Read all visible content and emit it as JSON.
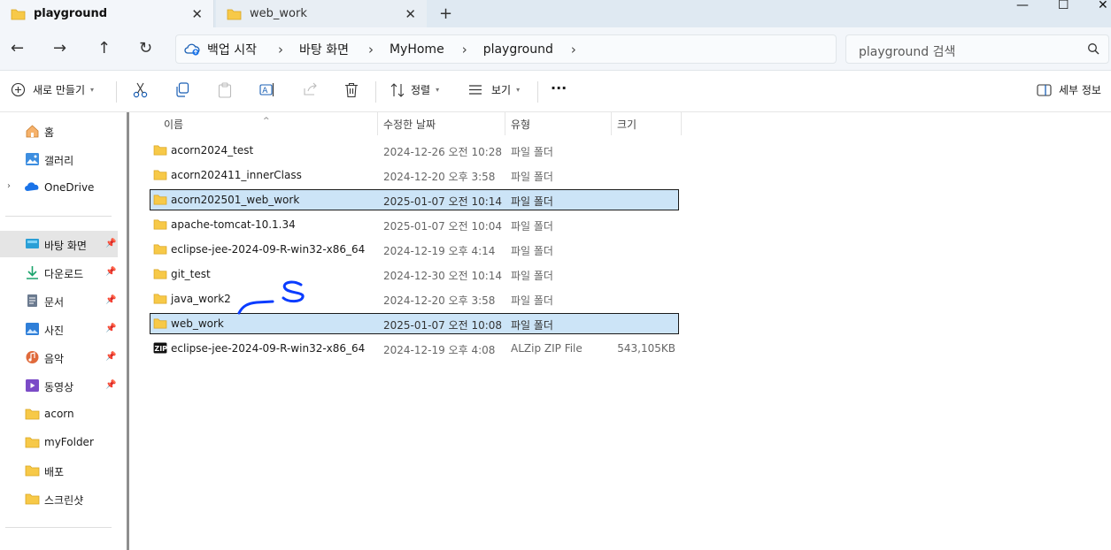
{
  "tabs": [
    {
      "label": "playground",
      "close": "✕"
    },
    {
      "label": "web_work",
      "close": "✕"
    }
  ],
  "new_tab": "+",
  "window_controls": {
    "minimize": "—",
    "maximize": "☐",
    "close": "✕"
  },
  "nav": {
    "back": "←",
    "forward": "→",
    "up": "↑",
    "refresh": "↻"
  },
  "breadcrumb": [
    {
      "label": "백업 시작"
    },
    {
      "label": "바탕 화면"
    },
    {
      "label": "MyHome"
    },
    {
      "label": "playground"
    }
  ],
  "breadcrumb_sep": "›",
  "search": {
    "placeholder": "playground 검색"
  },
  "toolbar": {
    "new_label": "새로 만들기",
    "sort_label": "정렬",
    "view_label": "보기",
    "more": "···",
    "details_label": "세부 정보"
  },
  "sidebar": {
    "pin": "📌",
    "expand": "›",
    "items": [
      {
        "label": "홈",
        "icon": "home-icon"
      },
      {
        "label": "갤러리",
        "icon": "gallery-icon"
      },
      {
        "label": "OneDrive",
        "icon": "onedrive-icon"
      },
      {
        "label": "바탕 화면",
        "icon": "desktop-icon"
      },
      {
        "label": "다운로드",
        "icon": "download-icon"
      },
      {
        "label": "문서",
        "icon": "document-icon"
      },
      {
        "label": "사진",
        "icon": "pictures-icon"
      },
      {
        "label": "음악",
        "icon": "music-icon"
      },
      {
        "label": "동영상",
        "icon": "video-icon"
      },
      {
        "label": "acorn",
        "icon": "folder-icon"
      },
      {
        "label": "myFolder",
        "icon": "folder-icon"
      },
      {
        "label": "배포",
        "icon": "folder-icon"
      },
      {
        "label": "스크린샷",
        "icon": "folder-icon"
      }
    ]
  },
  "columns": {
    "name": "이름",
    "modified": "수정한 날짜",
    "type": "유형",
    "size": "크기",
    "sort_indicator": "^"
  },
  "files": [
    {
      "name": "acorn2024_test",
      "modified": "2024-12-26 오전 10:28",
      "type": "파일 폴더",
      "size": "",
      "icon": "folder-icon"
    },
    {
      "name": "acorn202411_innerClass",
      "modified": "2024-12-20 오후 3:58",
      "type": "파일 폴더",
      "size": "",
      "icon": "folder-icon"
    },
    {
      "name": "acorn202501_web_work",
      "modified": "2025-01-07 오전 10:14",
      "type": "파일 폴더",
      "size": "",
      "icon": "folder-icon",
      "highlighted": true
    },
    {
      "name": "apache-tomcat-10.1.34",
      "modified": "2025-01-07 오전 10:04",
      "type": "파일 폴더",
      "size": "",
      "icon": "folder-icon"
    },
    {
      "name": "eclipse-jee-2024-09-R-win32-x86_64",
      "modified": "2024-12-19 오후 4:14",
      "type": "파일 폴더",
      "size": "",
      "icon": "folder-icon"
    },
    {
      "name": "git_test",
      "modified": "2024-12-30 오전 10:14",
      "type": "파일 폴더",
      "size": "",
      "icon": "folder-icon"
    },
    {
      "name": "java_work2",
      "modified": "2024-12-20 오후 3:58",
      "type": "파일 폴더",
      "size": "",
      "icon": "folder-icon"
    },
    {
      "name": "web_work",
      "modified": "2025-01-07 오전 10:08",
      "type": "파일 폴더",
      "size": "",
      "icon": "folder-icon",
      "highlighted": true
    },
    {
      "name": "eclipse-jee-2024-09-R-win32-x86_64",
      "modified": "2024-12-19 오후 4:08",
      "type": "ALZip ZIP File",
      "size": "543,105KB",
      "icon": "zip-icon"
    }
  ],
  "colors": {
    "accent": "#0067c0",
    "folder": "#f7c948",
    "highlight": "#cce4f7",
    "ink": "#0a3cff"
  }
}
